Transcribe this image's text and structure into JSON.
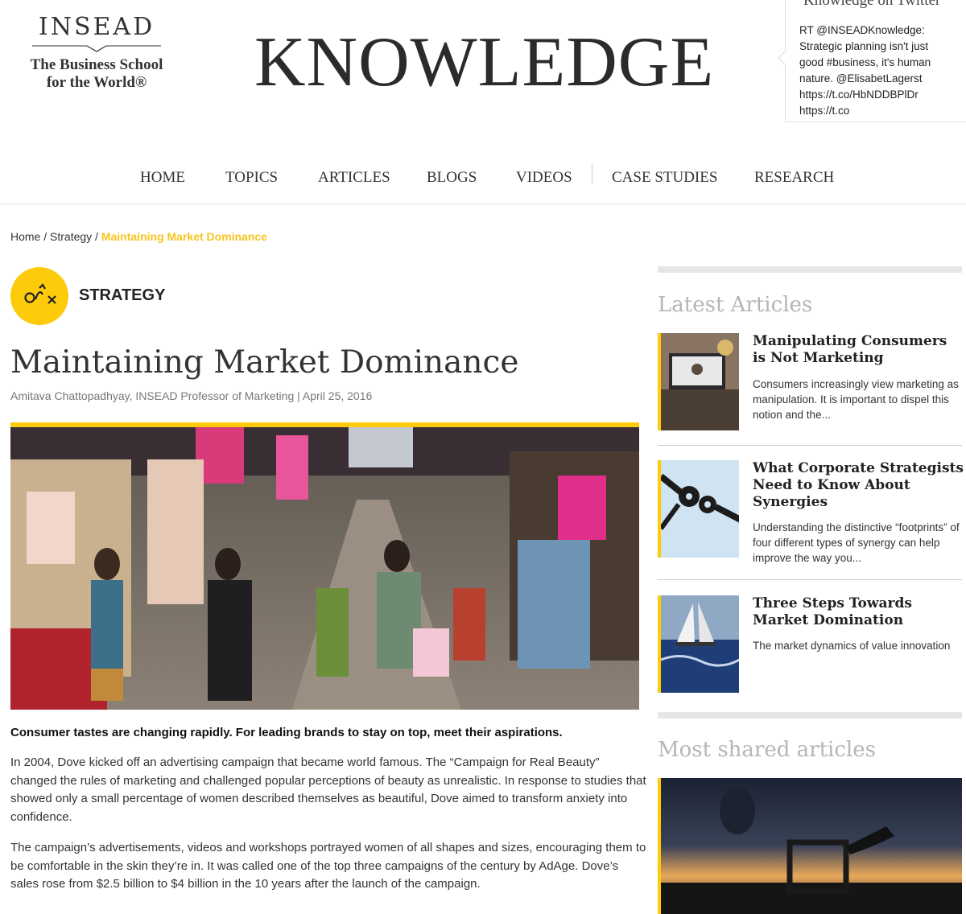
{
  "header": {
    "logo_name": "INSEAD",
    "logo_tagline_1": "The Business School",
    "logo_tagline_2": "for the World®",
    "site_title": "KNOWLEDGE"
  },
  "twitter": {
    "title": "Knowledge on Twitter",
    "lines": [
      "RT @INSEADKnowledge:",
      "Strategic planning isn't just",
      "good #business, it's human",
      "nature. @ElisabetLagerst",
      "https://t.co/HbNDDBPlDr",
      "https://t.co"
    ]
  },
  "nav": {
    "items": [
      "HOME",
      "TOPICS",
      "ARTICLES",
      "BLOGS",
      "VIDEOS",
      "CASE STUDIES",
      "RESEARCH"
    ]
  },
  "breadcrumb": {
    "home": "Home",
    "sep": " / ",
    "section": "Strategy",
    "current": "Maintaining Market Dominance"
  },
  "topic": {
    "label": "STRATEGY",
    "icon": "strategy-icon"
  },
  "article": {
    "title": "Maintaining Market Dominance",
    "author": "Amitava Chattopadhyay",
    "byline_rest": ", INSEAD Professor of Marketing | April 25, 2016",
    "lead": "Consumer tastes are changing rapidly. For leading brands to stay on top, meet their aspirations.",
    "paragraphs": [
      "In 2004, Dove kicked off an advertising campaign that became world famous. The “Campaign for Real Beauty” changed the rules of marketing and challenged popular perceptions of beauty as unrealistic. In response to studies that showed only a small percentage of women described themselves as beautiful, Dove aimed to transform anxiety into confidence.",
      "The campaign’s advertisements, videos and workshops portrayed women of all shapes and sizes, encouraging them to be comfortable in the skin they’re in. It was called one of the top three campaigns of the century by AdAge. Dove’s sales rose from $2.5 billion to $4 billion in the 10 years after the launch of the campaign."
    ]
  },
  "sidebar": {
    "latest_heading": "Latest Articles",
    "latest": [
      {
        "title": "Manipulating Consumers is Not Marketing",
        "summary": "Consumers increasingly view marketing as manipulation. It is important to dispel this notion and the..."
      },
      {
        "title": "What Corporate Strategists Need to Know About Synergies",
        "summary": "Understanding the distinctive “footprints” of four different types of synergy can help improve the way you..."
      },
      {
        "title": "Three Steps Towards Market Domination",
        "summary": "The market dynamics of value innovation"
      }
    ],
    "shared_heading": "Most shared articles"
  },
  "colors": {
    "accent": "#fdcb0a",
    "breadcrumb_current": "#f7c41f",
    "sidebar_heading": "#b5b5b5"
  }
}
